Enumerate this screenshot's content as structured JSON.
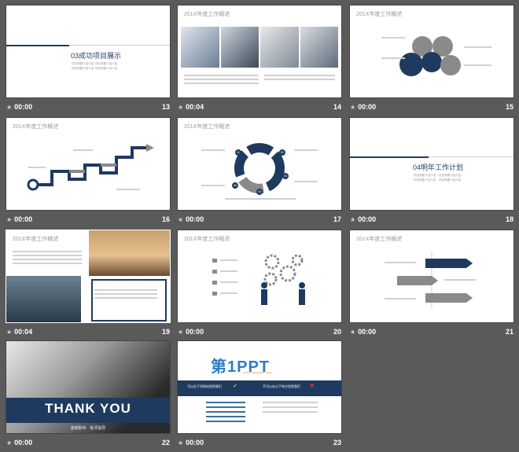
{
  "slides": [
    {
      "num": "13",
      "time": "00:00",
      "title": "03成功项目展示",
      "bullets": [
        "·项目简要介绍介绍",
        "·项目简要介绍介绍",
        "·项目简要介绍介绍",
        "·项目简要介绍介绍"
      ]
    },
    {
      "num": "14",
      "time": "00:04",
      "title": "201X年度工作概述"
    },
    {
      "num": "15",
      "time": "00:00",
      "title": "201X年度工作概述"
    },
    {
      "num": "16",
      "time": "00:00",
      "title": "201X年度工作概述"
    },
    {
      "num": "17",
      "time": "00:00",
      "title": "201X年度工作概述",
      "labels": [
        "01",
        "02",
        "03",
        "04",
        "05"
      ]
    },
    {
      "num": "18",
      "time": "00:00",
      "title": "04明年工作计划",
      "bullets": [
        "·项目简要介绍介绍",
        "·项目简要介绍介绍",
        "·项目简要介绍介绍",
        "·项目简要介绍介绍"
      ]
    },
    {
      "num": "19",
      "time": "00:04",
      "title": "201X年度工作概述"
    },
    {
      "num": "20",
      "time": "00:00",
      "title": "201X年度工作概述"
    },
    {
      "num": "21",
      "time": "00:00",
      "title": "201X年度工作概述"
    },
    {
      "num": "22",
      "time": "00:00",
      "title": "THANK YOU",
      "subtitle": "谢谢聆听 · 批评指导"
    },
    {
      "num": "23",
      "time": "00:00",
      "logo": "第1PPT",
      "url": "HTTP://WWW.1PPT.COM/",
      "left_head": "可以在下列网站找到我们",
      "right_head": "不可以在以下地方找到我们"
    }
  ]
}
